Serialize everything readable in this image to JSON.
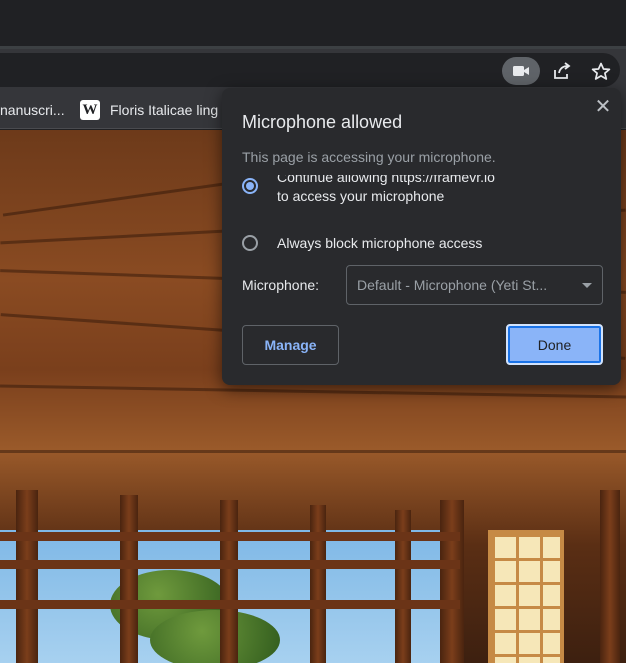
{
  "toolbar": {
    "icons": [
      "camera-icon",
      "share-icon",
      "star-icon"
    ]
  },
  "bookmarks": [
    {
      "label": "nanuscri..."
    },
    {
      "label": "Floris Italicae ling",
      "icon": "W"
    }
  ],
  "popup": {
    "title": "Microphone allowed",
    "subtitle": "This page is accessing your microphone.",
    "option_allow": "Continue allowing https://framevr.io to access your microphone",
    "option_block": "Always block microphone access",
    "selected_option": "allow",
    "mic_label": "Microphone:",
    "mic_value": "Default - Microphone (Yeti St...",
    "manage_label": "Manage",
    "done_label": "Done"
  },
  "colors": {
    "accent": "#8ab4f8",
    "popup_bg": "#292a2d",
    "chrome_bg": "#35363a"
  }
}
